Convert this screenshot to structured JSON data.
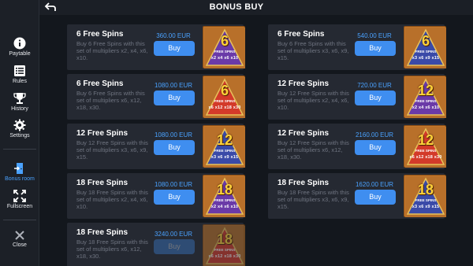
{
  "header": {
    "title": "BONUS BUY",
    "back_icon": "back-arrow-icon"
  },
  "sidebar": {
    "items": [
      {
        "label": "Paytable",
        "icon": "info-icon",
        "active": false
      },
      {
        "label": "Rules",
        "icon": "list-icon",
        "active": false
      },
      {
        "label": "History",
        "icon": "trophy-icon",
        "active": false
      },
      {
        "label": "Settings",
        "icon": "gear-icon",
        "active": false
      },
      {
        "label": "Bonus room",
        "icon": "door-icon",
        "active": true
      },
      {
        "label": "Fullscreen",
        "icon": "fullscreen-icon",
        "active": false
      },
      {
        "label": "Close",
        "icon": "close-icon",
        "active": false
      }
    ]
  },
  "offers": [
    {
      "name": "6 Free Spins",
      "desc": "Buy 6 Free Spins with this set of multipliers x2, x4, x6, x10.",
      "price": "360.00 EUR",
      "buy_label": "Buy",
      "tile_number": "6",
      "tile_fs": "FREE SPINS",
      "tile_mult": "x2 x4 x6 x10",
      "tile_color": "#6a3aa8"
    },
    {
      "name": "6 Free Spins",
      "desc": "Buy 6 Free Spins with this set of multipliers x3, x6, x9, x15.",
      "price": "540.00 EUR",
      "buy_label": "Buy",
      "tile_number": "6",
      "tile_fs": "FREE SPINS",
      "tile_mult": "x3 x6 x9 x15",
      "tile_color": "#3a4aa8"
    },
    {
      "name": "6 Free Spins",
      "desc": "Buy 6 Free Spins with this set of multipliers x6, x12, x18, x30.",
      "price": "1080.00 EUR",
      "buy_label": "Buy",
      "tile_number": "6",
      "tile_fs": "FREE SPINS",
      "tile_mult": "x6 x12 x18 x30",
      "tile_color": "#d33a2a"
    },
    {
      "name": "12 Free Spins",
      "desc": "Buy 12 Free Spins with this set of multipliers x2, x4, x6, x10.",
      "price": "720.00 EUR",
      "buy_label": "Buy",
      "tile_number": "12",
      "tile_fs": "FREE SPINS",
      "tile_mult": "x2 x4 x6 x10",
      "tile_color": "#6a3aa8"
    },
    {
      "name": "12 Free Spins",
      "desc": "Buy 12 Free Spins with this set of multipliers x3, x6, x9, x15.",
      "price": "1080.00 EUR",
      "buy_label": "Buy",
      "tile_number": "12",
      "tile_fs": "FREE SPINS",
      "tile_mult": "x3 x6 x9 x15",
      "tile_color": "#3a4aa8"
    },
    {
      "name": "12 Free Spins",
      "desc": "Buy 12 Free Spins with this set of multipliers x6, x12, x18, x30.",
      "price": "2160.00 EUR",
      "buy_label": "Buy",
      "tile_number": "12",
      "tile_fs": "FREE SPINS",
      "tile_mult": "x6 x12 x18 x30",
      "tile_color": "#d33a2a"
    },
    {
      "name": "18 Free Spins",
      "desc": "Buy 18 Free Spins with this set of multipliers x2, x4, x6, x10.",
      "price": "1080.00 EUR",
      "buy_label": "Buy",
      "tile_number": "18",
      "tile_fs": "FREE SPINS",
      "tile_mult": "x2 x4 x6 x10",
      "tile_color": "#6a3aa8"
    },
    {
      "name": "18 Free Spins",
      "desc": "Buy 18 Free Spins with this set of multipliers x3, x6, x9, x15.",
      "price": "1620.00 EUR",
      "buy_label": "Buy",
      "tile_number": "18",
      "tile_fs": "FREE SPINS",
      "tile_mult": "x3 x6 x9 x15",
      "tile_color": "#3a4aa8"
    },
    {
      "name": "18 Free Spins",
      "desc": "Buy 18 Free Spins with this set of multipliers x6, x12, x18, x30.",
      "price": "3240.00 EUR",
      "buy_label": "Buy",
      "tile_number": "18",
      "tile_fs": "FREE SPINS",
      "tile_mult": "x6 x12 x18 x30",
      "tile_color": "#d33a2a"
    }
  ],
  "colors": {
    "accent": "#3f8ef0",
    "price": "#4aa2ff",
    "tile_bg": "#c4772b"
  }
}
